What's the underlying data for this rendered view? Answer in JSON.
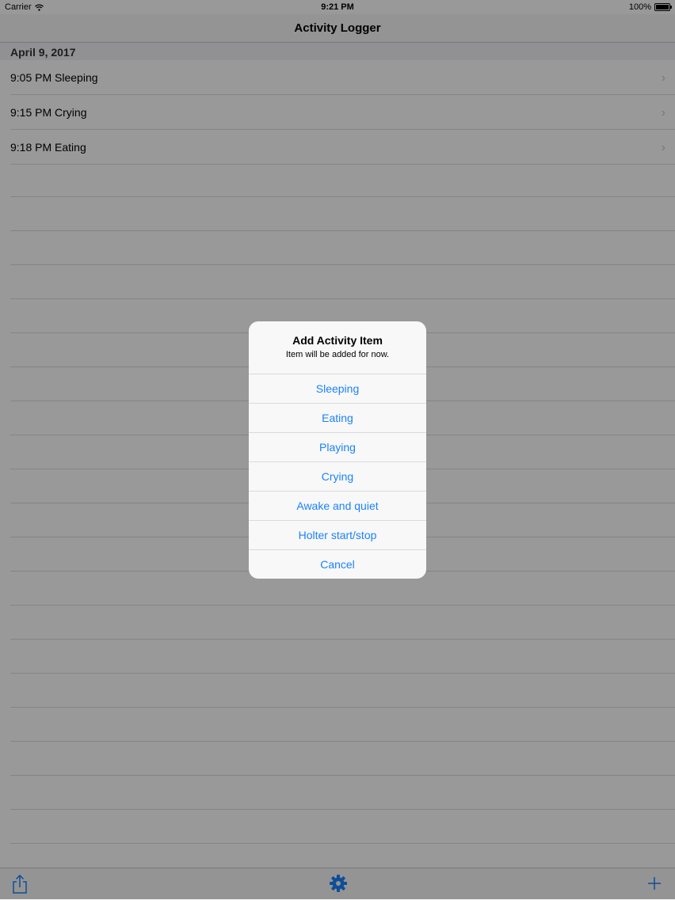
{
  "status_bar": {
    "carrier": "Carrier",
    "time": "9:21 PM",
    "battery": "100%",
    "battery_level": 1.0
  },
  "nav": {
    "title": "Activity Logger"
  },
  "section": {
    "header": "April 9, 2017"
  },
  "rows": [
    {
      "label": "9:05 PM Sleeping"
    },
    {
      "label": "9:15 PM Crying"
    },
    {
      "label": "9:18 PM Eating"
    }
  ],
  "alert": {
    "title": "Add Activity Item",
    "message": "Item will be added for now.",
    "actions": [
      "Sleeping",
      "Eating",
      "Playing",
      "Crying",
      "Awake and quiet",
      "Holter start/stop",
      "Cancel"
    ]
  },
  "icons": {
    "share": "share-icon",
    "settings": "gear-icon",
    "add": "plus-icon",
    "disclosure": "chevron-right-icon",
    "wifi": "wifi-icon"
  },
  "colors": {
    "tint": "#1a82fb",
    "overlay": "rgba(0,0,0,0.40)"
  }
}
